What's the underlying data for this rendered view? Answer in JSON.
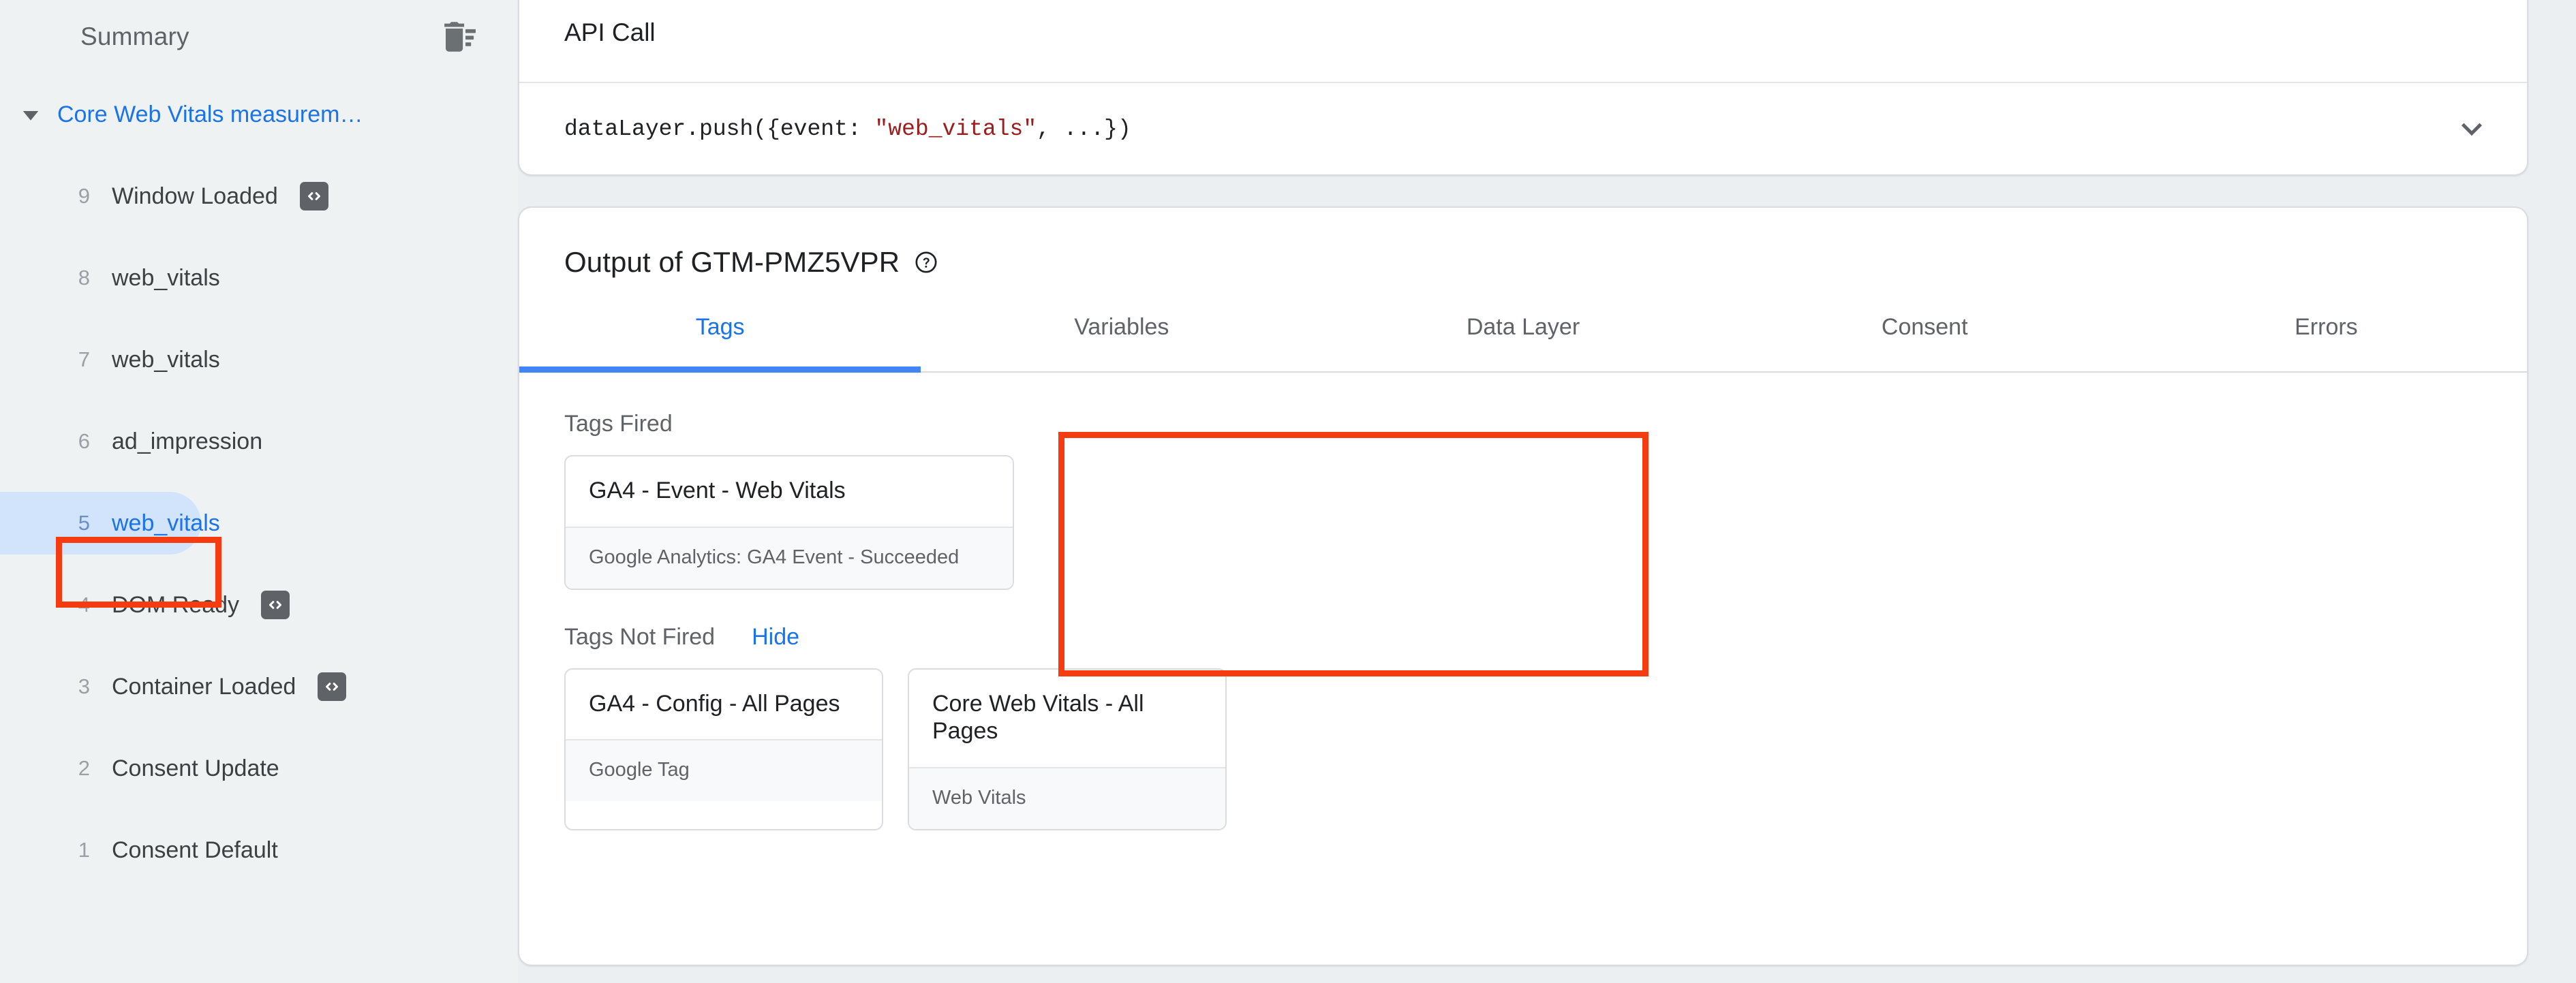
{
  "theme": {
    "accent": "#1a73e8",
    "tab_underline": "#4285f4",
    "highlight": "#f53b10",
    "selected_pill": "#d2e3fc",
    "page_bg": "#eceff1",
    "sidebar_bg": "#eff2f3",
    "code_string": "#9c1c1c"
  },
  "sidebar": {
    "title": "Summary",
    "clear_icon": "trash-list-icon",
    "group": {
      "caret_icon": "caret-down-icon",
      "label": "Core Web Vitals measurem…"
    },
    "events": [
      {
        "num": "9",
        "name": "Window Loaded",
        "badge": "code-icon"
      },
      {
        "num": "8",
        "name": "web_vitals",
        "badge": ""
      },
      {
        "num": "7",
        "name": "web_vitals",
        "badge": ""
      },
      {
        "num": "6",
        "name": "ad_impression",
        "badge": ""
      },
      {
        "num": "5",
        "name": "web_vitals",
        "badge": "",
        "selected": true
      },
      {
        "num": "4",
        "name": "DOM Ready",
        "badge": "code-icon"
      },
      {
        "num": "3",
        "name": "Container Loaded",
        "badge": "code-icon"
      },
      {
        "num": "2",
        "name": "Consent Update",
        "badge": ""
      },
      {
        "num": "1",
        "name": "Consent Default",
        "badge": ""
      }
    ]
  },
  "api_call": {
    "title": "API Call",
    "code_prefix": "dataLayer.push({event: ",
    "code_string": "\"web_vitals\"",
    "code_suffix": ", ...})",
    "expand_icon": "chevron-down-icon"
  },
  "output": {
    "title": "Output of GTM-PMZ5VPR",
    "help_icon": "help-circle-icon",
    "tabs": [
      {
        "label": "Tags",
        "active": true
      },
      {
        "label": "Variables",
        "active": false
      },
      {
        "label": "Data Layer",
        "active": false
      },
      {
        "label": "Consent",
        "active": false
      },
      {
        "label": "Errors",
        "active": false
      }
    ],
    "tags_fired": {
      "title": "Tags Fired",
      "items": [
        {
          "name": "GA4 - Event - Web Vitals",
          "meta": "Google Analytics: GA4 Event - Succeeded"
        }
      ]
    },
    "tags_not_fired": {
      "title": "Tags Not Fired",
      "toggle_label": "Hide",
      "items": [
        {
          "name": "GA4 - Config - All Pages",
          "meta": "Google Tag"
        },
        {
          "name": "Core Web Vitals - All Pages",
          "meta": "Web Vitals"
        }
      ]
    }
  }
}
